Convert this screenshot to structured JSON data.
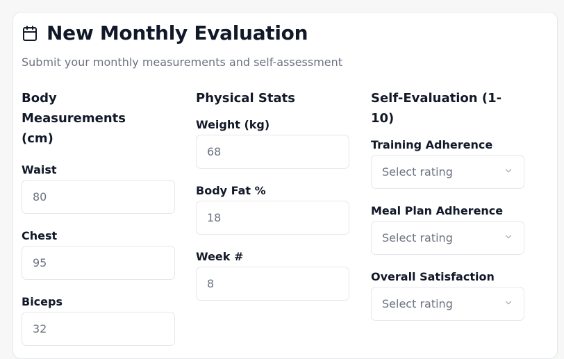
{
  "header": {
    "title": "New Monthly Evaluation",
    "subtitle": "Submit your monthly measurements and self-assessment",
    "icon": "calendar-icon"
  },
  "columns": [
    {
      "heading": "Body Measurements (cm)",
      "fields": [
        {
          "label": "Waist",
          "placeholder": "80"
        },
        {
          "label": "Chest",
          "placeholder": "95"
        },
        {
          "label": "Biceps",
          "placeholder": "32"
        }
      ]
    },
    {
      "heading": "Physical Stats",
      "fields": [
        {
          "label": "Weight (kg)",
          "placeholder": "68"
        },
        {
          "label": "Body Fat %",
          "placeholder": "18"
        },
        {
          "label": "Week #",
          "placeholder": "8"
        }
      ]
    },
    {
      "heading": "Self-Evaluation (1-10)",
      "fields": [
        {
          "label": "Training Adherence",
          "placeholder": "Select rating",
          "icon": "chevron-down-icon"
        },
        {
          "label": "Meal Plan Adherence",
          "placeholder": "Select rating",
          "icon": "chevron-down-icon"
        },
        {
          "label": "Overall Satisfaction",
          "placeholder": "Select rating",
          "icon": "chevron-down-icon"
        }
      ]
    }
  ],
  "colors": {
    "text": "#111827",
    "muted": "#6b7280",
    "border": "#e5e7eb",
    "background": "#f7f7f8",
    "card": "#ffffff"
  }
}
